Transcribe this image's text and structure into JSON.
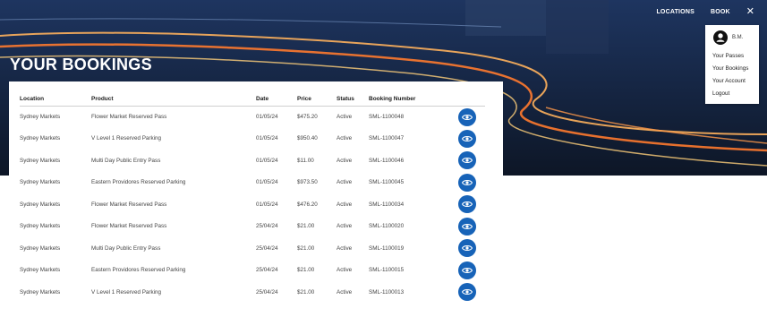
{
  "nav": {
    "links": [
      "LOCATIONS",
      "BOOK"
    ],
    "close_glyph": "✕"
  },
  "page": {
    "title": "YOUR BOOKINGS"
  },
  "account_menu": {
    "initials": "B.M.",
    "items": [
      "Your Passes",
      "Your Bookings",
      "Your Account",
      "Logout"
    ]
  },
  "table": {
    "headers": [
      "Location",
      "Product",
      "Date",
      "Price",
      "Status",
      "Booking Number"
    ],
    "rows": [
      [
        "Sydney Markets",
        "Flower Market Reserved Pass",
        "01/05/24",
        "$475.20",
        "Active",
        "SML-1100048"
      ],
      [
        "Sydney Markets",
        "V Level 1 Reserved Parking",
        "01/05/24",
        "$950.40",
        "Active",
        "SML-1100047"
      ],
      [
        "Sydney Markets",
        "Multi Day Public Entry Pass",
        "01/05/24",
        "$11.00",
        "Active",
        "SML-1100046"
      ],
      [
        "Sydney Markets",
        "Eastern Providores Reserved Parking",
        "01/05/24",
        "$973.50",
        "Active",
        "SML-1100045"
      ],
      [
        "Sydney Markets",
        "Flower Market Reserved Pass",
        "01/05/24",
        "$476.20",
        "Active",
        "SML-1100034"
      ],
      [
        "Sydney Markets",
        "Flower Market Reserved Pass",
        "25/04/24",
        "$21.00",
        "Active",
        "SML-1100020"
      ],
      [
        "Sydney Markets",
        "Multi Day Public Entry Pass",
        "25/04/24",
        "$21.00",
        "Active",
        "SML-1100019"
      ],
      [
        "Sydney Markets",
        "Eastern Providores Reserved Parking",
        "25/04/24",
        "$21.00",
        "Active",
        "SML-1100015"
      ],
      [
        "Sydney Markets",
        "V Level 1 Reserved Parking",
        "25/04/24",
        "$21.00",
        "Active",
        "SML-1100013"
      ]
    ],
    "action_icon": "eye-icon"
  },
  "colors": {
    "accent": "#1763b8",
    "hero_dark": "#0f1c33",
    "light_trail": "#ff8a3d"
  }
}
